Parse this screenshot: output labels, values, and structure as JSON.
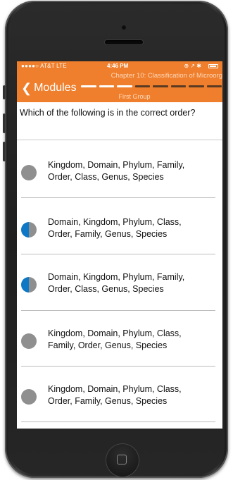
{
  "status_bar": {
    "carrier": "●●●●○ AT&T  LTE",
    "time": "4:46 PM",
    "right_icons": "⊕ ↗ ✱"
  },
  "app_bar": {
    "back_label": "Modules",
    "chapter_title": "Chapter 10: Classification of Microorg",
    "group_label": "First Group",
    "progress_segments": [
      "#ffffff",
      "#ffffff",
      "#ffffff",
      "#5a3a22",
      "#5a3a22",
      "#5a3a22",
      "#5a3a22",
      "#5a3a22"
    ]
  },
  "question": {
    "text": "Which of the following is in the correct order?"
  },
  "options": [
    {
      "line1": "Kingdom, Domain, Phylum, Family,",
      "line2": "Order, Class, Genus, Species",
      "marker": "gray"
    },
    {
      "line1": "Domain, Kingdom, Phylum, Class,",
      "line2": "Order, Family, Genus, Species",
      "marker": "half-blue"
    },
    {
      "line1": "Domain, Kingdom, Phylum, Family,",
      "line2": "Order, Class, Genus, Species",
      "marker": "half-blue"
    },
    {
      "line1": "Kingdom, Domain, Phylum, Class,",
      "line2": "Family, Order, Genus, Species",
      "marker": "gray"
    },
    {
      "line1": "Kingdom, Domain, Phylum, Class,",
      "line2": "Order, Family, Genus, Species",
      "marker": "gray"
    }
  ],
  "colors": {
    "accent_orange": "#ef7f2d",
    "selection_blue": "#0e78c7",
    "marker_gray": "#8f8f8f"
  }
}
